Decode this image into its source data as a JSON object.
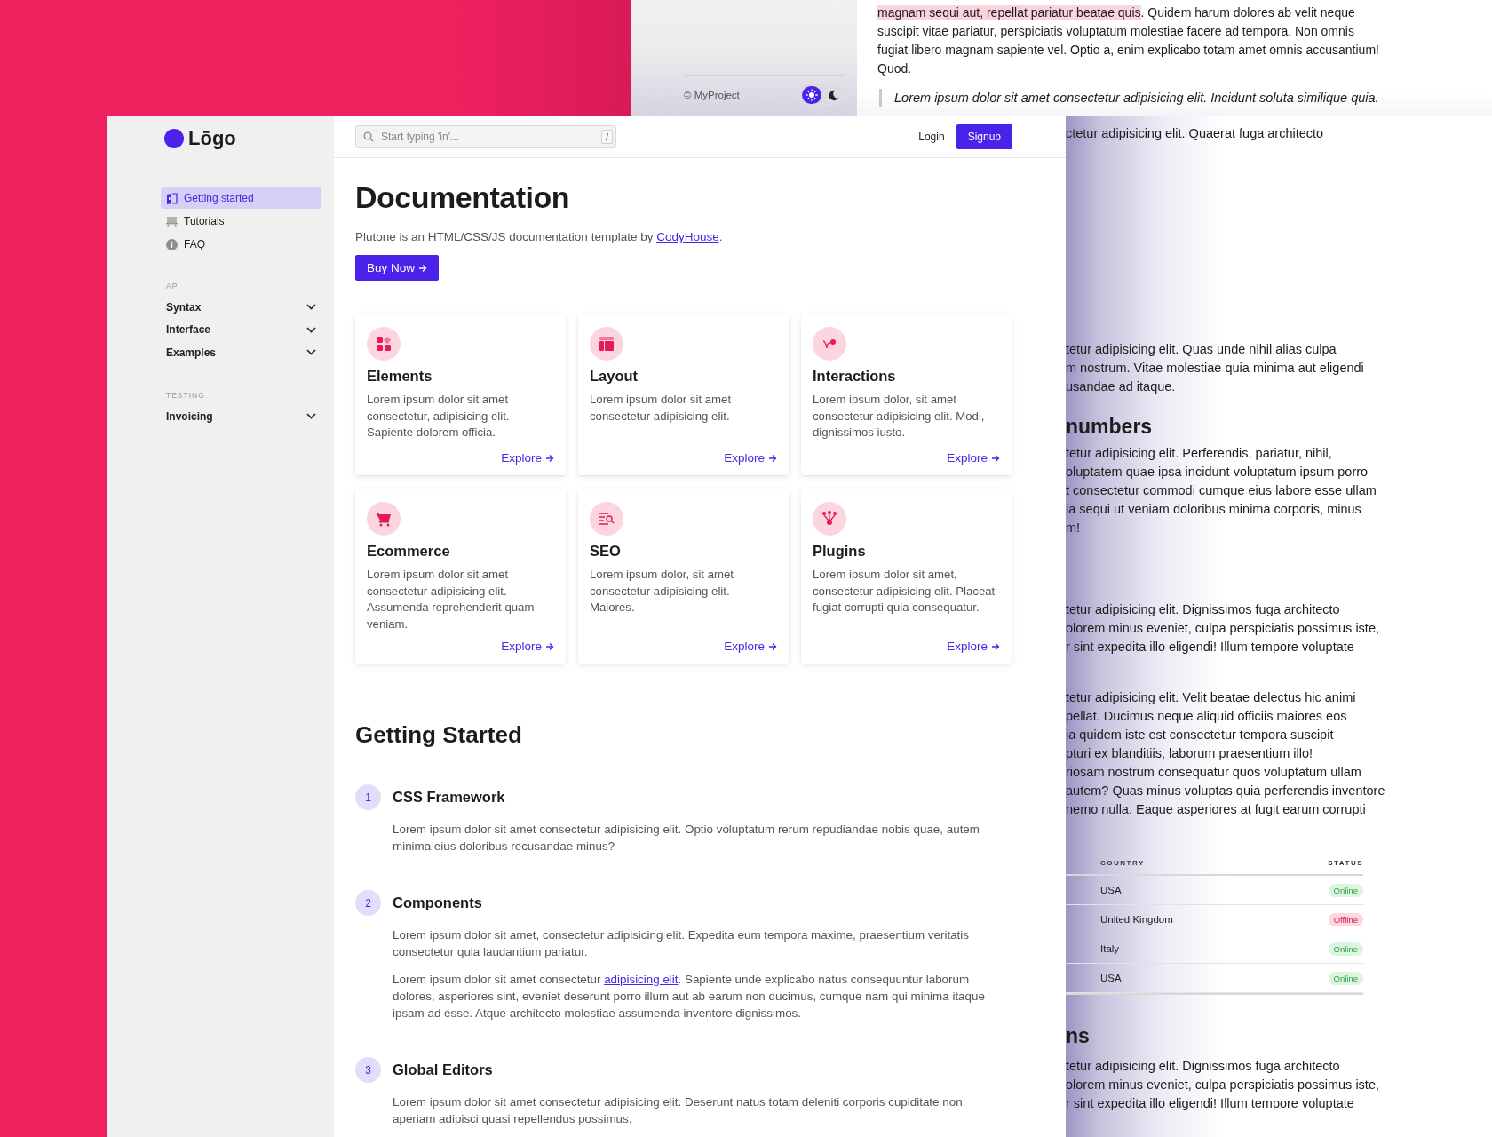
{
  "back_window": {
    "footer": {
      "copyright": "© MyProject",
      "theme_toggle": [
        {
          "kind": "sun",
          "selected": true
        },
        {
          "kind": "moon",
          "selected": false
        }
      ]
    }
  },
  "article": {
    "intro": {
      "highlight": "magnam sequi aut, repellat pariatur beatae quis",
      "lines": [
        ". Quidem harum dolores ab velit neque",
        "suscipit vitae pariatur, perspiciatis voluptatum molestiae facere ad tempora. Non omnis",
        "fugiat libero magnam sapiente vel. Optio a, enim explicabo totam amet omnis accusantium!",
        "Quod."
      ]
    },
    "quote": "Lorem ipsum dolor sit amet consectetur adipisicing elit. Incidunt soluta similique quia.",
    "blocks": [
      {
        "kind": "paragraph",
        "lines": [
          "ctetur adipisicing elit. Quaerat fuga architecto"
        ]
      },
      {
        "kind": "paragraph",
        "lines": [
          "tetur adipisicing elit. Quas unde nihil alias culpa",
          "m nostrum. Vitae molestiae quia minima aut eligendi",
          "usandae ad itaque."
        ]
      },
      {
        "kind": "heading",
        "text": "numbers"
      },
      {
        "kind": "paragraph",
        "lines": [
          "tetur adipisicing elit. Perferendis, pariatur, nihil,",
          "oluptatem quae ipsa incidunt voluptatum ipsum porro",
          "t consectetur commodi cumque eius labore esse ullam",
          "ia sequi ut veniam doloribus minima corporis, minus",
          "m!"
        ]
      },
      {
        "kind": "paragraph",
        "lines": [
          "tetur adipisicing elit. Dignissimos fuga architecto",
          "olorem minus eveniet, culpa perspiciatis possimus iste,",
          "r sint expedita illo eligendi! Illum tempore voluptate"
        ]
      },
      {
        "kind": "paragraph",
        "lines": [
          "tetur adipisicing elit. Velit beatae delectus hic animi",
          "pellat. Ducimus neque aliquid officiis maiores eos",
          "ia quidem iste est consectetur tempora suscipit",
          "pturi ex blanditiis, laborum praesentium illo!",
          "riosam nostrum consequatur quos voluptatum ullam",
          "autem? Quas minus voluptas quia perferendis inventore",
          "nemo nulla. Eaque asperiores at fugit earum corrupti"
        ]
      },
      {
        "kind": "table",
        "columns": [
          "COUNTRY",
          "STATUS"
        ],
        "rows": [
          {
            "country": "USA",
            "status": "Online",
            "kind": "online"
          },
          {
            "country": "United Kingdom",
            "status": "Offline",
            "kind": "offline"
          },
          {
            "country": "Italy",
            "status": "Online",
            "kind": "online"
          },
          {
            "country": "USA",
            "status": "Online",
            "kind": "online"
          }
        ]
      },
      {
        "kind": "heading",
        "text": "ns"
      },
      {
        "kind": "paragraph",
        "lines": [
          "tetur adipisicing elit. Dignissimos fuga architecto",
          "olorem minus eveniet, culpa perspiciatis possimus iste,",
          "r sint expedita illo eligendi! Illum tempore voluptate"
        ]
      }
    ]
  },
  "sidebar": {
    "logo": "Lōgo",
    "items": [
      {
        "label": "Getting started",
        "kind": "book",
        "selected": true
      },
      {
        "label": "Tutorials",
        "kind": "easel",
        "selected": false
      },
      {
        "label": "FAQ",
        "kind": "info",
        "selected": false
      }
    ],
    "sections": [
      {
        "title": "API",
        "items": [
          {
            "label": "Syntax",
            "expanded": false
          },
          {
            "label": "Interface",
            "expanded": false
          },
          {
            "label": "Examples",
            "expanded": false
          }
        ]
      },
      {
        "title": "TESTING",
        "items": [
          {
            "label": "Invoicing",
            "expanded": false
          }
        ]
      }
    ]
  },
  "header": {
    "search": {
      "placeholder": "Start typing 'in'...",
      "shortcut": "/"
    },
    "login": "Login",
    "signup": "Signup"
  },
  "hero": {
    "title": "Documentation",
    "description": {
      "before": "Plutone is an HTML/CSS/JS documentation template by ",
      "link": "CodyHouse",
      "after": "."
    },
    "button": "Buy Now"
  },
  "cards": [
    {
      "kind": "elements",
      "title": "Elements",
      "text": "Lorem ipsum dolor sit amet consectetur, adipisicing elit. Sapiente dolorem officia.",
      "link": "Explore"
    },
    {
      "kind": "layout",
      "title": "Layout",
      "text": "Lorem ipsum dolor sit amet consectetur adipisicing elit.",
      "link": "Explore"
    },
    {
      "kind": "interactions",
      "title": "Interactions",
      "text": "Lorem ipsum dolor, sit amet consectetur adipisicing elit. Modi, dignissimos iusto.",
      "link": "Explore"
    },
    {
      "kind": "ecommerce",
      "title": "Ecommerce",
      "text": "Lorem ipsum dolor sit amet consectetur adipisicing elit. Assumenda reprehenderit quam veniam.",
      "link": "Explore"
    },
    {
      "kind": "seo",
      "title": "SEO",
      "text": "Lorem ipsum dolor, sit amet consectetur adipisicing elit. Maiores.",
      "link": "Explore"
    },
    {
      "kind": "plugins",
      "title": "Plugins",
      "text": "Lorem ipsum dolor sit amet, consectetur adipisicing elit. Placeat fugiat corrupti quia consequatur.",
      "link": "Explore"
    }
  ],
  "getting_started": {
    "title": "Getting Started",
    "steps": [
      {
        "number": "1",
        "title": "CSS Framework",
        "paragraphs": [
          {
            "text": "Lorem ipsum dolor sit amet consectetur adipisicing elit. Optio voluptatum rerum repudiandae nobis quae, autem minima eius doloribus recusandae minus?"
          }
        ]
      },
      {
        "number": "2",
        "title": "Components",
        "paragraphs": [
          {
            "text": "Lorem ipsum dolor sit amet, consectetur adipisicing elit. Expedita eum tempora maxime, praesentium veritatis consectetur quia laudantium pariatur."
          },
          {
            "text": "Lorem ipsum dolor sit amet consectetur ",
            "link": "adipisicing elit",
            "after": ". Sapiente unde explicabo natus consequuntur laborum dolores, asperiores sint, eveniet deserunt porro illum aut ab earum non ducimus, cumque nam qui minima itaque ipsam ad esse. Atque architecto molestiae assumenda inventore dignissimos."
          }
        ]
      },
      {
        "number": "3",
        "title": "Global Editors",
        "paragraphs": [
          {
            "text": "Lorem ipsum dolor sit amet consectetur adipisicing elit. Deserunt natus totam deleniti corporis cupiditate non aperiam adipisci quasi repellendus possimus."
          }
        ]
      }
    ]
  }
}
